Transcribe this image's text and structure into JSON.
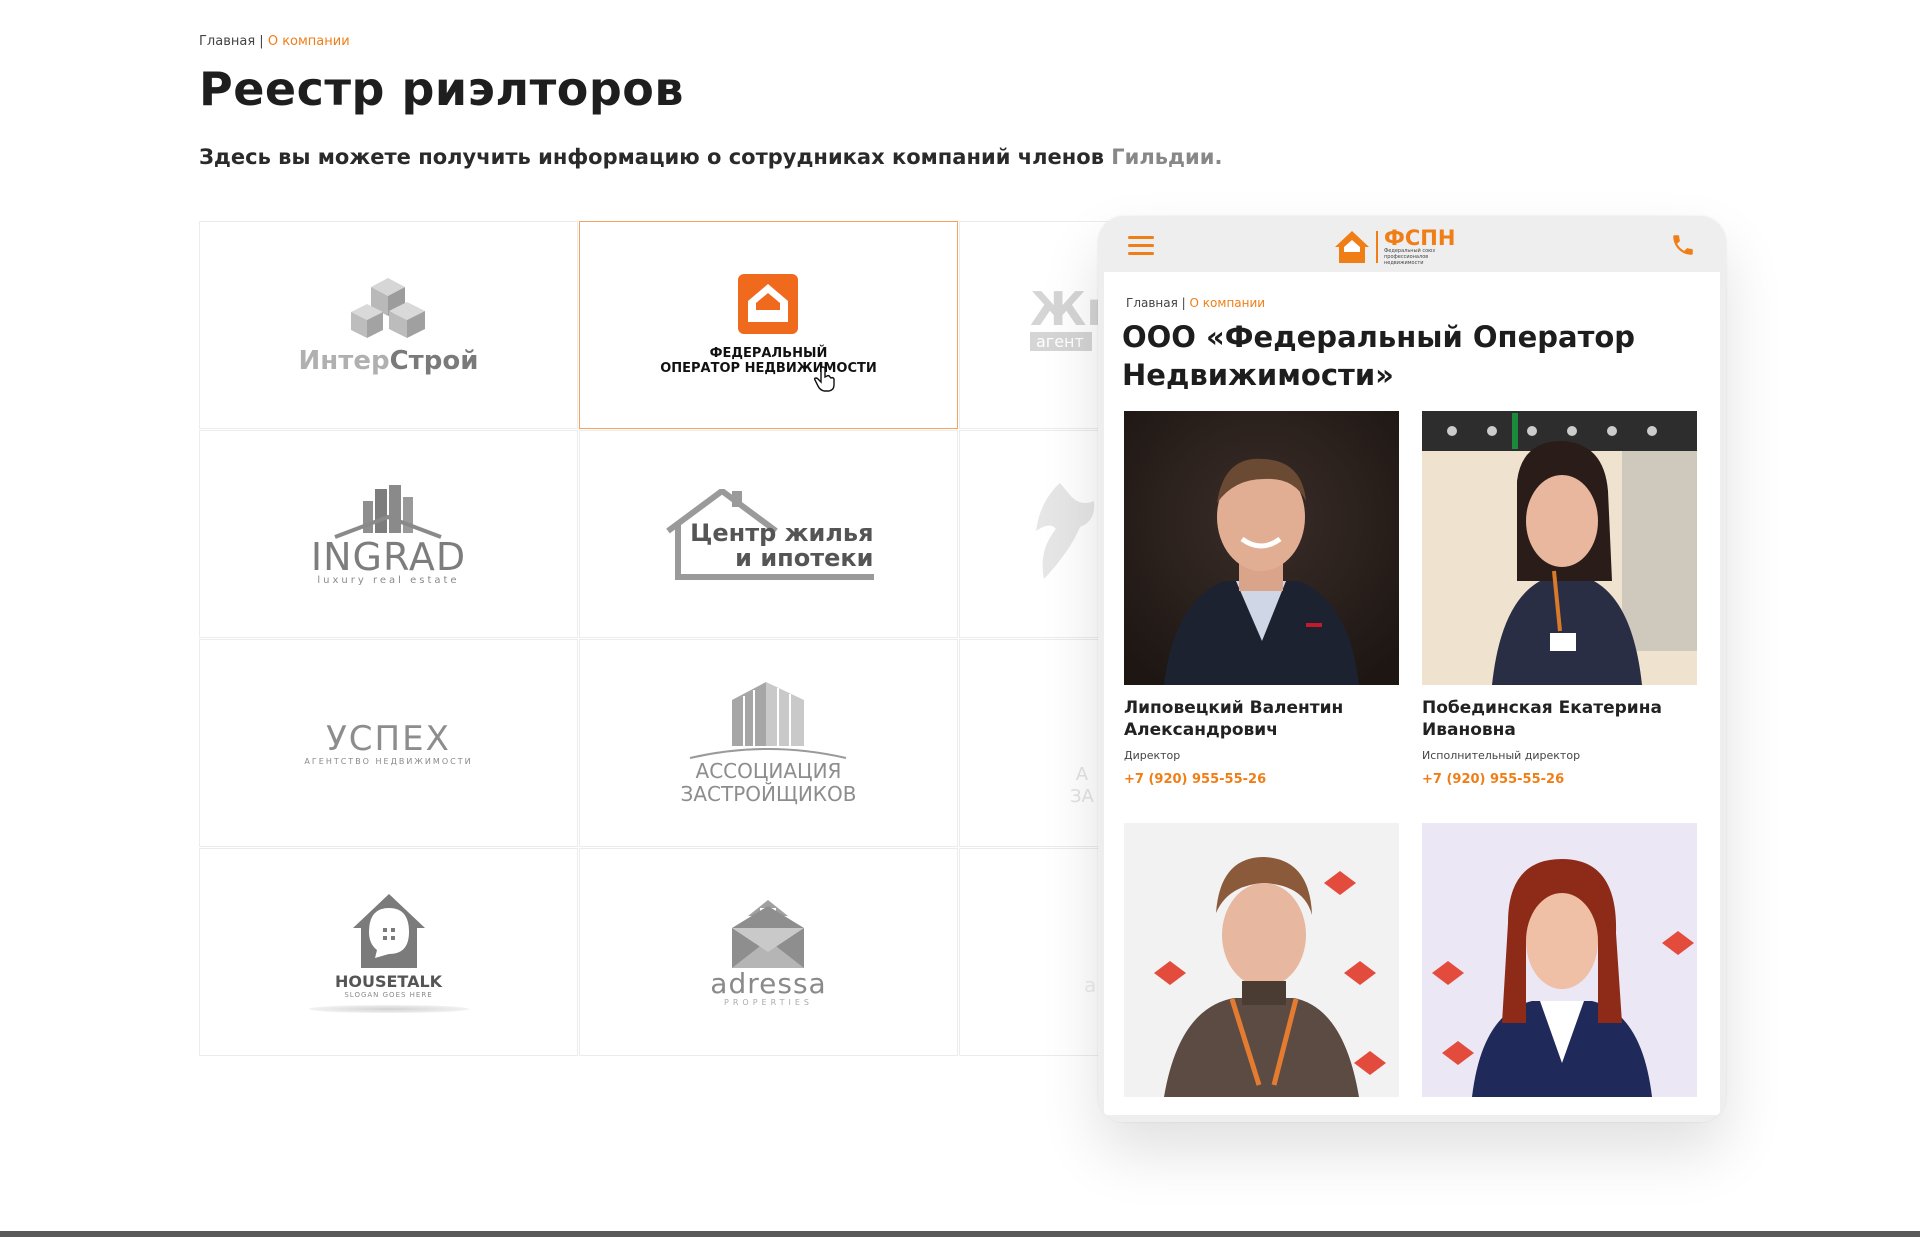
{
  "breadcrumb": {
    "home": "Главная",
    "separator": "|",
    "current": "О компании"
  },
  "page": {
    "title": "Реестр риэлторов",
    "subtitle_main": "Здесь вы можете получить информацию о сотрудниках компаний членов",
    "subtitle_fade": "Гильдии."
  },
  "logos": [
    {
      "name": "ИнтерСтрой",
      "parts": [
        "Интер",
        "Строй"
      ]
    },
    {
      "name": "ФЕДЕРАЛЬНЫЙ ОПЕРАТОР НЕДВИЖИМОСТИ",
      "line1": "ФЕДЕРАЛЬНЫЙ",
      "line2": "ОПЕРАТОР НЕДВИЖИМОСТИ"
    },
    {
      "name": "Жи агент",
      "line1": "Жи",
      "line2": "агент"
    },
    {
      "name": "INGRAD",
      "line1": "INGRAD",
      "line2": "luxury real estate"
    },
    {
      "name": "Центр жилья и ипотеки",
      "line1": "Центр жилья",
      "line2": "и ипотеки"
    },
    {
      "name": "eagle"
    },
    {
      "name": "УСПЕХ",
      "line1": "УСПЕХ",
      "line2": "АГЕНТСТВО НЕДВИЖИМОСТИ"
    },
    {
      "name": "АССОЦИАЦИЯ ЗАСТРОЙЩИКОВ",
      "line1": "АССОЦИАЦИЯ",
      "line2": "ЗАСТРОЙЩИКОВ"
    },
    {
      "name": "АЗА",
      "line1": "А",
      "line2": "ЗА"
    },
    {
      "name": "HOUSETALK",
      "line1": "HOUSETALK",
      "line2": "SLOGAN GOES HERE"
    },
    {
      "name": "adressa",
      "line1": "adressa",
      "line2": "PROPERTIES"
    },
    {
      "name": "a",
      "line1": "a"
    }
  ],
  "mobile": {
    "brand": {
      "name": "ФСПН",
      "sub": "Федеральный союз профессионалов недвижимости"
    },
    "breadcrumb": {
      "home": "Главная",
      "separator": "|",
      "current": "О компании"
    },
    "title": "ООО «Федеральный Оператор Недвижимости»",
    "employees": [
      {
        "name": "Липовецкий Валентин Александрович",
        "role": "Директор",
        "phone": "+7 (920) 955-55-26"
      },
      {
        "name": "Побединская Екатерина Ивановна",
        "role": "Исполнительный директор",
        "phone": "+7 (920) 955-55-26"
      },
      {
        "name": "",
        "role": "",
        "phone": ""
      },
      {
        "name": "",
        "role": "",
        "phone": ""
      }
    ]
  },
  "colors": {
    "accent": "#f07e17",
    "text": "#222222",
    "logo_gray": "#8a8a8a"
  },
  "icons": [
    "menu-icon",
    "phone-icon",
    "cursor-hand-icon",
    "house-logo-icon"
  ]
}
